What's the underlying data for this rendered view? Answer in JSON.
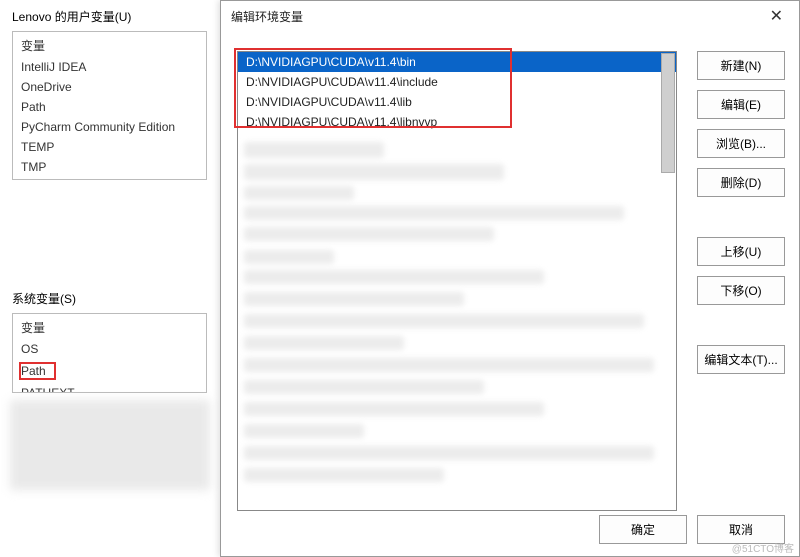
{
  "back_panel": {
    "user_vars_label": "Lenovo 的用户变量(U)",
    "user_vars_header": "变量",
    "user_vars": [
      "IntelliJ IDEA",
      "OneDrive",
      "Path",
      "PyCharm Community Edition",
      "TEMP",
      "TMP"
    ],
    "sys_vars_label": "系统变量(S)",
    "sys_vars_header": "变量",
    "sys_vars": [
      "OS",
      "Path",
      "PATHEXT"
    ]
  },
  "dialog": {
    "title": "编辑环境变量",
    "close": "✕",
    "paths": [
      "D:\\NVIDIAGPU\\CUDA\\v11.4\\bin",
      "D:\\NVIDIAGPU\\CUDA\\v11.4\\include",
      "D:\\NVIDIAGPU\\CUDA\\v11.4\\lib",
      "D:\\NVIDIAGPU\\CUDA\\v11.4\\libnvvp"
    ],
    "selected_index": 0,
    "buttons": {
      "new": "新建(N)",
      "edit": "编辑(E)",
      "browse": "浏览(B)...",
      "delete": "删除(D)",
      "move_up": "上移(U)",
      "move_down": "下移(O)",
      "edit_text": "编辑文本(T)...",
      "ok": "确定",
      "cancel": "取消"
    }
  },
  "watermark": "@51CTO博客"
}
